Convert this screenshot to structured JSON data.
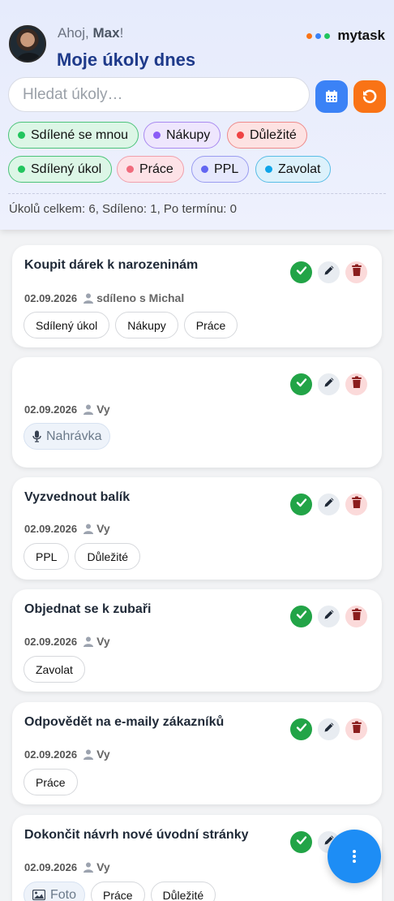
{
  "header": {
    "greeting_prefix": "Ahoj, ",
    "user_name": "Max",
    "greeting_suffix": "!",
    "title": "Moje úkoly dnes",
    "brand": "mytask",
    "brand_dot_colors": [
      "#f97316",
      "#3b82f6",
      "#22c55e"
    ]
  },
  "search": {
    "placeholder": "Hledat úkoly…",
    "value": ""
  },
  "buttons": {
    "calendar_icon": "calendar-icon",
    "reset_icon": "reset-icon"
  },
  "filter_tags": [
    {
      "label": "Sdílené se mnou",
      "color": "#22c55e",
      "bg": "#dcf6e6",
      "border": "#4cc37a"
    },
    {
      "label": "Nákupy",
      "color": "#8b5cf6",
      "bg": "#eee6fd",
      "border": "#a98af0"
    },
    {
      "label": "Důležité",
      "color": "#ef4444",
      "bg": "#fde2e2",
      "border": "#ee8a8a"
    },
    {
      "label": "Sdílený úkol",
      "color": "#22c55e",
      "bg": "#dcf6e6",
      "border": "#4cc37a"
    },
    {
      "label": "Práce",
      "color": "#f06b7c",
      "bg": "#fde2e7",
      "border": "#f0a0ac"
    },
    {
      "label": "PPL",
      "color": "#6366f1",
      "bg": "#e6e8fd",
      "border": "#9a9cf0"
    },
    {
      "label": "Zavolat",
      "color": "#0ea5e9",
      "bg": "#dcf1fb",
      "border": "#58bde6"
    }
  ],
  "summary": "Úkolů celkem: 6, Sdíleno: 1, Po termínu: 0",
  "tasks": [
    {
      "title": "Koupit dárek k narozeninám",
      "date": "02.09.2026",
      "who": "sdíleno s Michal",
      "tags": [
        "Sdílený úkol",
        "Nákupy",
        "Práce"
      ]
    },
    {
      "title": "",
      "date": "02.09.2026",
      "who": "Vy",
      "media": "Nahrávka"
    },
    {
      "title": "Vyzvednout balík",
      "date": "02.09.2026",
      "who": "Vy",
      "tags": [
        "PPL",
        "Důležité"
      ]
    },
    {
      "title": "Objednat se k zubaři",
      "date": "02.09.2026",
      "who": "Vy",
      "tags": [
        "Zavolat"
      ]
    },
    {
      "title": "Odpovědět na e-maily zákazníků",
      "date": "02.09.2026",
      "who": "Vy",
      "tags": [
        "Práce"
      ]
    },
    {
      "title": "Dokončit návrh nové úvodní stránky",
      "date": "02.09.2026",
      "who": "Vy",
      "media": "Foto",
      "tags": [
        "Práce",
        "Důležité"
      ]
    }
  ],
  "fab_icon": "more-vertical-icon"
}
